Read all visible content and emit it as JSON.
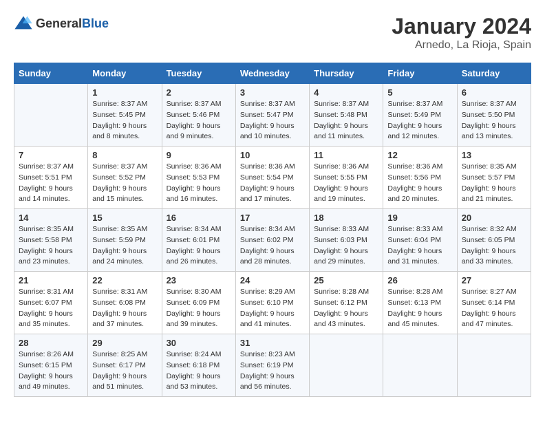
{
  "logo": {
    "text_general": "General",
    "text_blue": "Blue"
  },
  "calendar": {
    "title": "January 2024",
    "subtitle": "Arnedo, La Rioja, Spain"
  },
  "weekdays": [
    "Sunday",
    "Monday",
    "Tuesday",
    "Wednesday",
    "Thursday",
    "Friday",
    "Saturday"
  ],
  "weeks": [
    [
      {
        "day": "",
        "sunrise": "",
        "sunset": "",
        "daylight": ""
      },
      {
        "day": "1",
        "sunrise": "Sunrise: 8:37 AM",
        "sunset": "Sunset: 5:45 PM",
        "daylight": "Daylight: 9 hours and 8 minutes."
      },
      {
        "day": "2",
        "sunrise": "Sunrise: 8:37 AM",
        "sunset": "Sunset: 5:46 PM",
        "daylight": "Daylight: 9 hours and 9 minutes."
      },
      {
        "day": "3",
        "sunrise": "Sunrise: 8:37 AM",
        "sunset": "Sunset: 5:47 PM",
        "daylight": "Daylight: 9 hours and 10 minutes."
      },
      {
        "day": "4",
        "sunrise": "Sunrise: 8:37 AM",
        "sunset": "Sunset: 5:48 PM",
        "daylight": "Daylight: 9 hours and 11 minutes."
      },
      {
        "day": "5",
        "sunrise": "Sunrise: 8:37 AM",
        "sunset": "Sunset: 5:49 PM",
        "daylight": "Daylight: 9 hours and 12 minutes."
      },
      {
        "day": "6",
        "sunrise": "Sunrise: 8:37 AM",
        "sunset": "Sunset: 5:50 PM",
        "daylight": "Daylight: 9 hours and 13 minutes."
      }
    ],
    [
      {
        "day": "7",
        "sunrise": "Sunrise: 8:37 AM",
        "sunset": "Sunset: 5:51 PM",
        "daylight": "Daylight: 9 hours and 14 minutes."
      },
      {
        "day": "8",
        "sunrise": "Sunrise: 8:37 AM",
        "sunset": "Sunset: 5:52 PM",
        "daylight": "Daylight: 9 hours and 15 minutes."
      },
      {
        "day": "9",
        "sunrise": "Sunrise: 8:36 AM",
        "sunset": "Sunset: 5:53 PM",
        "daylight": "Daylight: 9 hours and 16 minutes."
      },
      {
        "day": "10",
        "sunrise": "Sunrise: 8:36 AM",
        "sunset": "Sunset: 5:54 PM",
        "daylight": "Daylight: 9 hours and 17 minutes."
      },
      {
        "day": "11",
        "sunrise": "Sunrise: 8:36 AM",
        "sunset": "Sunset: 5:55 PM",
        "daylight": "Daylight: 9 hours and 19 minutes."
      },
      {
        "day": "12",
        "sunrise": "Sunrise: 8:36 AM",
        "sunset": "Sunset: 5:56 PM",
        "daylight": "Daylight: 9 hours and 20 minutes."
      },
      {
        "day": "13",
        "sunrise": "Sunrise: 8:35 AM",
        "sunset": "Sunset: 5:57 PM",
        "daylight": "Daylight: 9 hours and 21 minutes."
      }
    ],
    [
      {
        "day": "14",
        "sunrise": "Sunrise: 8:35 AM",
        "sunset": "Sunset: 5:58 PM",
        "daylight": "Daylight: 9 hours and 23 minutes."
      },
      {
        "day": "15",
        "sunrise": "Sunrise: 8:35 AM",
        "sunset": "Sunset: 5:59 PM",
        "daylight": "Daylight: 9 hours and 24 minutes."
      },
      {
        "day": "16",
        "sunrise": "Sunrise: 8:34 AM",
        "sunset": "Sunset: 6:01 PM",
        "daylight": "Daylight: 9 hours and 26 minutes."
      },
      {
        "day": "17",
        "sunrise": "Sunrise: 8:34 AM",
        "sunset": "Sunset: 6:02 PM",
        "daylight": "Daylight: 9 hours and 28 minutes."
      },
      {
        "day": "18",
        "sunrise": "Sunrise: 8:33 AM",
        "sunset": "Sunset: 6:03 PM",
        "daylight": "Daylight: 9 hours and 29 minutes."
      },
      {
        "day": "19",
        "sunrise": "Sunrise: 8:33 AM",
        "sunset": "Sunset: 6:04 PM",
        "daylight": "Daylight: 9 hours and 31 minutes."
      },
      {
        "day": "20",
        "sunrise": "Sunrise: 8:32 AM",
        "sunset": "Sunset: 6:05 PM",
        "daylight": "Daylight: 9 hours and 33 minutes."
      }
    ],
    [
      {
        "day": "21",
        "sunrise": "Sunrise: 8:31 AM",
        "sunset": "Sunset: 6:07 PM",
        "daylight": "Daylight: 9 hours and 35 minutes."
      },
      {
        "day": "22",
        "sunrise": "Sunrise: 8:31 AM",
        "sunset": "Sunset: 6:08 PM",
        "daylight": "Daylight: 9 hours and 37 minutes."
      },
      {
        "day": "23",
        "sunrise": "Sunrise: 8:30 AM",
        "sunset": "Sunset: 6:09 PM",
        "daylight": "Daylight: 9 hours and 39 minutes."
      },
      {
        "day": "24",
        "sunrise": "Sunrise: 8:29 AM",
        "sunset": "Sunset: 6:10 PM",
        "daylight": "Daylight: 9 hours and 41 minutes."
      },
      {
        "day": "25",
        "sunrise": "Sunrise: 8:28 AM",
        "sunset": "Sunset: 6:12 PM",
        "daylight": "Daylight: 9 hours and 43 minutes."
      },
      {
        "day": "26",
        "sunrise": "Sunrise: 8:28 AM",
        "sunset": "Sunset: 6:13 PM",
        "daylight": "Daylight: 9 hours and 45 minutes."
      },
      {
        "day": "27",
        "sunrise": "Sunrise: 8:27 AM",
        "sunset": "Sunset: 6:14 PM",
        "daylight": "Daylight: 9 hours and 47 minutes."
      }
    ],
    [
      {
        "day": "28",
        "sunrise": "Sunrise: 8:26 AM",
        "sunset": "Sunset: 6:15 PM",
        "daylight": "Daylight: 9 hours and 49 minutes."
      },
      {
        "day": "29",
        "sunrise": "Sunrise: 8:25 AM",
        "sunset": "Sunset: 6:17 PM",
        "daylight": "Daylight: 9 hours and 51 minutes."
      },
      {
        "day": "30",
        "sunrise": "Sunrise: 8:24 AM",
        "sunset": "Sunset: 6:18 PM",
        "daylight": "Daylight: 9 hours and 53 minutes."
      },
      {
        "day": "31",
        "sunrise": "Sunrise: 8:23 AM",
        "sunset": "Sunset: 6:19 PM",
        "daylight": "Daylight: 9 hours and 56 minutes."
      },
      {
        "day": "",
        "sunrise": "",
        "sunset": "",
        "daylight": ""
      },
      {
        "day": "",
        "sunrise": "",
        "sunset": "",
        "daylight": ""
      },
      {
        "day": "",
        "sunrise": "",
        "sunset": "",
        "daylight": ""
      }
    ]
  ]
}
